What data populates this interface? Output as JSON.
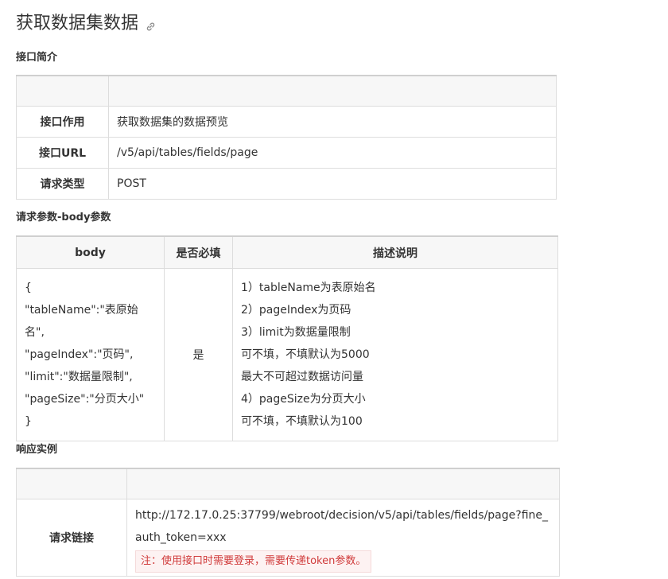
{
  "page_title": "获取数据集数据",
  "sections": {
    "intro": "接口简介",
    "params": "请求参数-body参数",
    "response": "响应实例"
  },
  "intro_table": {
    "rows": [
      {
        "key": "接口作用",
        "value": "获取数据集的数据预览"
      },
      {
        "key": "接口URL",
        "value": "/v5/api/tables/fields/page"
      },
      {
        "key": "请求类型",
        "value": "POST"
      }
    ]
  },
  "params_table": {
    "headers": [
      "body",
      "是否必填",
      "描述说明"
    ],
    "body_lines": [
      "{",
      "\"tableName\":\"表原始名\",",
      "\"pageIndex\":\"页码\",",
      "\"limit\":\"数据量限制\",",
      "\"pageSize\":\"分页大小\"",
      "}"
    ],
    "required": "是",
    "desc_lines": [
      "1）tableName为表原始名",
      "2）pageIndex为页码",
      "3）limit为数据量限制",
      "可不填，不填默认为5000",
      "最大不可超过数据访问量",
      "4）pageSize为分页大小",
      "可不填，不填默认为100"
    ]
  },
  "response_table": {
    "key": "请求链接",
    "url": "http://172.17.0.25:37799/webroot/decision/v5/api/tables/fields/page?fine_auth_token=xxx",
    "note": "注：使用接口时需要登录，需要传递token参数。"
  },
  "icons": {
    "anchor": "link-icon"
  }
}
